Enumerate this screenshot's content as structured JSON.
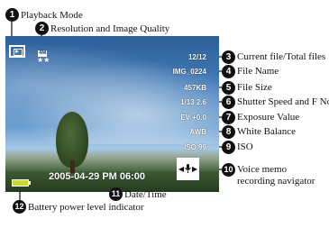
{
  "callouts": [
    {
      "number": "1",
      "label": "Playback Mode"
    },
    {
      "number": "2",
      "label": "Resolution and Image Quality"
    },
    {
      "number": "3",
      "label": "Current file/Total files"
    },
    {
      "number": "4",
      "label": "File Name"
    },
    {
      "number": "5",
      "label": "File Size"
    },
    {
      "number": "6",
      "label": "Shutter Speed and F No."
    },
    {
      "number": "7",
      "label": "Exposure Value"
    },
    {
      "number": "8",
      "label": "White Balance"
    },
    {
      "number": "9",
      "label": "ISO"
    },
    {
      "number": "10",
      "label": "Voice memo",
      "label2": "recording navigator"
    },
    {
      "number": "11",
      "label": "Date/Time"
    },
    {
      "number": "12",
      "label": "Battery power level indicator"
    }
  ],
  "screen": {
    "resolution_badge": "4M",
    "quality_stars": "★★",
    "file_count": "12/12",
    "file_name": "IMG_0224",
    "file_size": "457KB",
    "shutter_fno": "1/13 2.6",
    "exposure": "EV +0.0",
    "white_balance": "AWB",
    "iso": "ISO 99",
    "memo_left": "◀",
    "memo_right": "▶",
    "datetime": "2005-04-29  PM 06:00"
  }
}
